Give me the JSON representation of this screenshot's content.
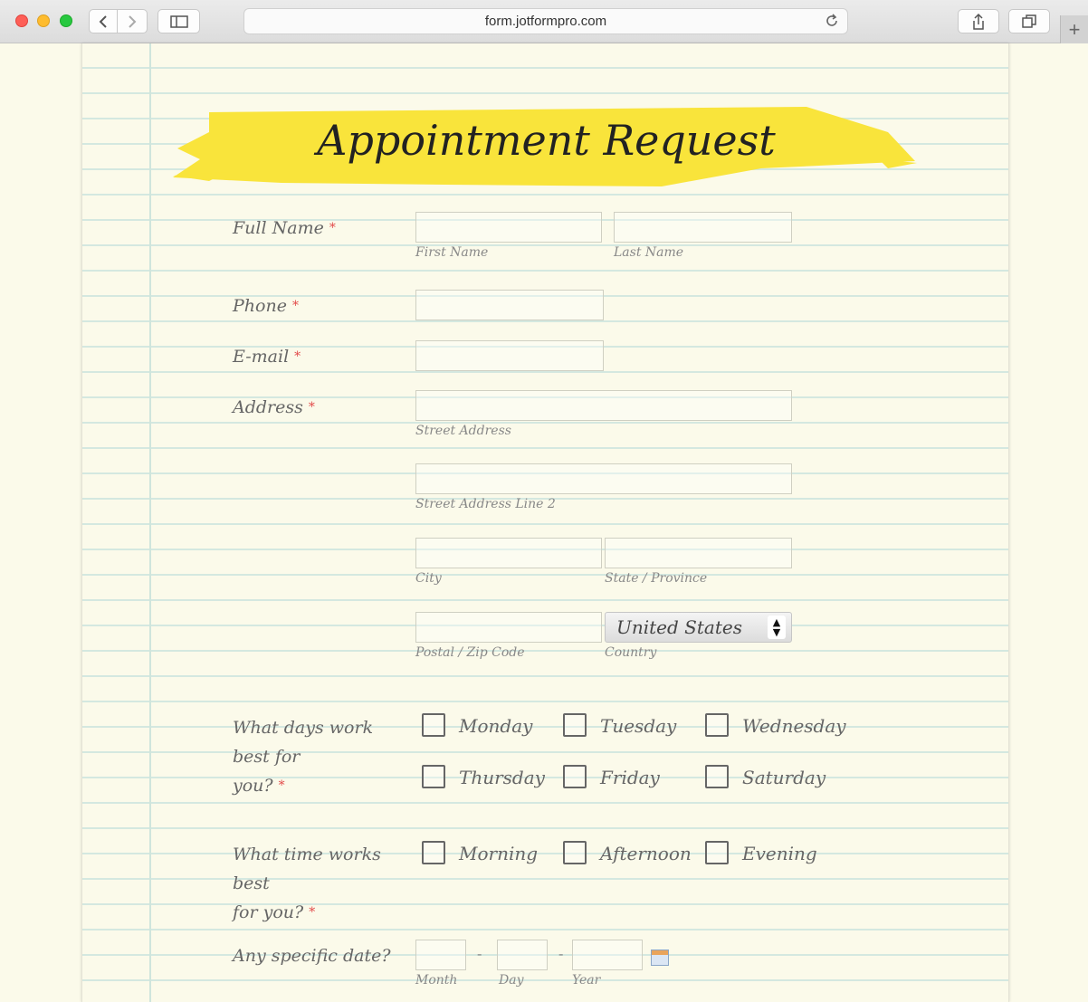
{
  "browser": {
    "url": "form.jotformpro.com"
  },
  "form": {
    "title": "Appointment Request",
    "required_mark": "*",
    "full_name": {
      "label": "Full Name",
      "first_sub": "First Name",
      "last_sub": "Last Name"
    },
    "phone": {
      "label": "Phone"
    },
    "email": {
      "label": "E-mail"
    },
    "address": {
      "label": "Address",
      "street_sub": "Street Address",
      "street2_sub": "Street Address Line 2",
      "city_sub": "City",
      "state_sub": "State / Province",
      "postal_sub": "Postal / Zip Code",
      "country_sub": "Country",
      "country_value": "United States"
    },
    "days": {
      "label_line1": "What days work best for",
      "label_line2": "you?",
      "options": [
        "Monday",
        "Tuesday",
        "Wednesday",
        "Thursday",
        "Friday",
        "Saturday"
      ]
    },
    "times": {
      "label_line1": "What time works best",
      "label_line2": "for you?",
      "options": [
        "Morning",
        "Afternoon",
        "Evening"
      ]
    },
    "date": {
      "label": "Any specific date?",
      "month_sub": "Month",
      "day_sub": "Day",
      "year_sub": "Year",
      "separator": "-"
    }
  }
}
